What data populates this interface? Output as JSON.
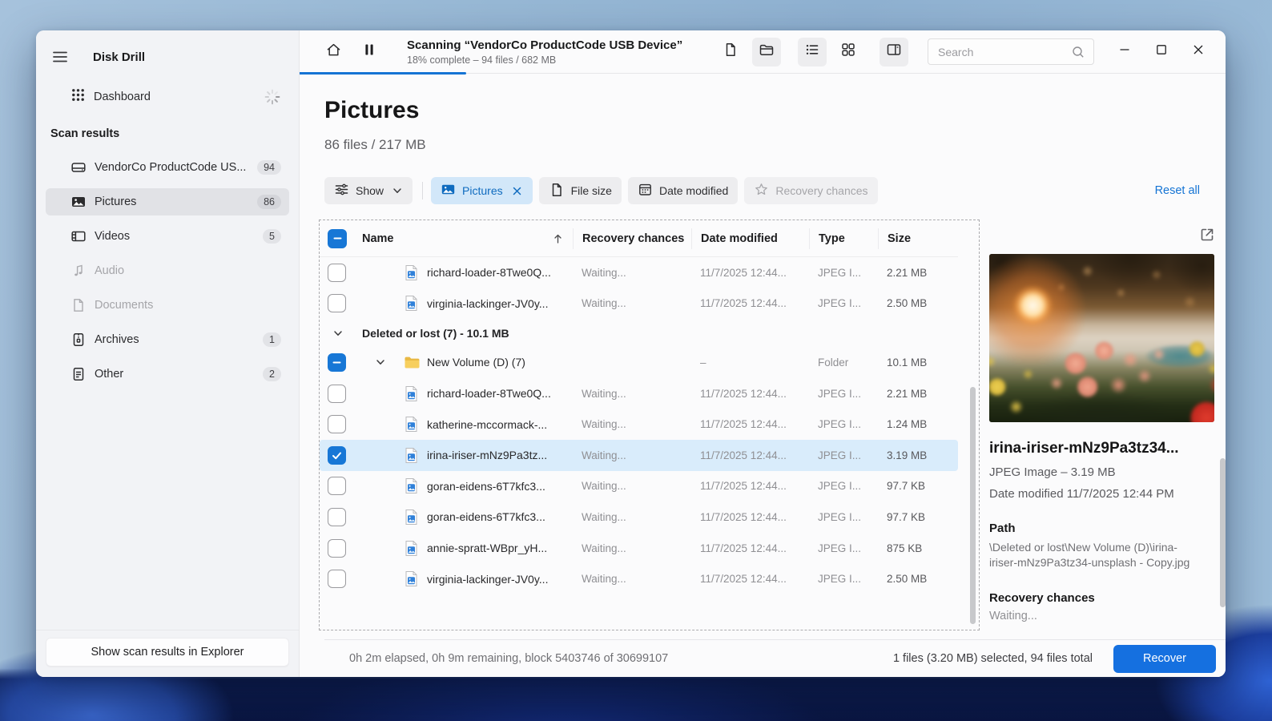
{
  "colors": {
    "accent": "#1574d4",
    "progress_bar": "#1574d4",
    "selection_row": "#d9ecfb",
    "chip_active_bg": "#d2e7f9",
    "chip_active_text": "#0f6bbf",
    "recover_button": "#1570e0",
    "sidebar_bg": "#f2f3f6"
  },
  "sidebar": {
    "title": "Disk Drill",
    "dashboard": {
      "label": "Dashboard",
      "icon": "dashboard",
      "spinner_icon": "spinner"
    },
    "section_header": "Scan results",
    "items": [
      {
        "label": "VendorCo ProductCode US...",
        "count": "94",
        "icon": "drive",
        "state": "normal"
      },
      {
        "label": "Pictures",
        "count": "86",
        "icon": "pictures",
        "state": "selected"
      },
      {
        "label": "Videos",
        "count": "5",
        "icon": "videos",
        "state": "normal"
      },
      {
        "label": "Audio",
        "count": "",
        "icon": "audio",
        "state": "disabled"
      },
      {
        "label": "Documents",
        "count": "",
        "icon": "documents",
        "state": "disabled"
      },
      {
        "label": "Archives",
        "count": "1",
        "icon": "archives",
        "state": "normal"
      },
      {
        "label": "Other",
        "count": "2",
        "icon": "other",
        "state": "normal"
      }
    ],
    "footer_button": "Show scan results in Explorer"
  },
  "header": {
    "title": "Scanning “VendorCo ProductCode USB Device”",
    "subtitle": "18% complete – 94 files / 682 MB",
    "progress_percent": 18,
    "search_placeholder": "Search",
    "toolbar_left": [
      {
        "icon": "home",
        "name": "home-button"
      },
      {
        "icon": "pause",
        "name": "pause-scan-button"
      }
    ],
    "toolbar_right": [
      {
        "icon": "file",
        "name": "file-view-button",
        "active": false
      },
      {
        "icon": "folder-open",
        "name": "folder-view-button",
        "active": true
      },
      {
        "icon": "list-view",
        "name": "list-view-button",
        "active": true
      },
      {
        "icon": "grid-view",
        "name": "grid-view-button",
        "active": false
      },
      {
        "icon": "preview-panel",
        "name": "toggle-preview-panel-button",
        "active": true
      }
    ],
    "window_controls": [
      {
        "icon": "minimize",
        "name": "minimize-button"
      },
      {
        "icon": "maximize",
        "name": "maximize-button"
      },
      {
        "icon": "close",
        "name": "close-button"
      }
    ]
  },
  "main": {
    "title": "Pictures",
    "subtitle": "86 files / 217 MB",
    "filters": {
      "show": {
        "label": "Show",
        "icon": "sliders"
      },
      "chips": [
        {
          "label": "Pictures",
          "icon": "image-blue",
          "variant": "active",
          "closable": true
        },
        {
          "label": "File size",
          "icon": "file",
          "variant": "default"
        },
        {
          "label": "Date modified",
          "icon": "calendar",
          "variant": "default"
        },
        {
          "label": "Recovery chances",
          "icon": "star",
          "variant": "disabled"
        }
      ],
      "reset_label": "Reset all"
    }
  },
  "table": {
    "columns": [
      "Name",
      "Recovery chances",
      "Date modified",
      "Type",
      "Size"
    ],
    "select_all_state": "indeterminate",
    "sort_icon": "sort-ascending",
    "rows": [
      {
        "kind": "file",
        "name": "richard-loader-8Twe0Q...",
        "recovery": "Waiting...",
        "date": "11/7/2025 12:44...",
        "type": "JPEG I...",
        "size": "2.21 MB",
        "checkbox": "unchecked",
        "selected": false
      },
      {
        "kind": "file",
        "name": "virginia-lackinger-JV0y...",
        "recovery": "Waiting...",
        "date": "11/7/2025 12:44...",
        "type": "JPEG I...",
        "size": "2.50 MB",
        "checkbox": "unchecked",
        "selected": false
      },
      {
        "kind": "group",
        "label": "Deleted or lost (7) - 10.1 MB"
      },
      {
        "kind": "folder",
        "name": "New Volume (D) (7)",
        "recovery": "",
        "date": "–",
        "type": "Folder",
        "size": "10.1 MB",
        "checkbox": "indeterminate",
        "selected": false
      },
      {
        "kind": "file",
        "name": "richard-loader-8Twe0Q...",
        "recovery": "Waiting...",
        "date": "11/7/2025 12:44...",
        "type": "JPEG I...",
        "size": "2.21 MB",
        "checkbox": "unchecked",
        "selected": false
      },
      {
        "kind": "file",
        "name": "katherine-mccormack-...",
        "recovery": "Waiting...",
        "date": "11/7/2025 12:44...",
        "type": "JPEG I...",
        "size": "1.24 MB",
        "checkbox": "unchecked",
        "selected": false
      },
      {
        "kind": "file",
        "name": "irina-iriser-mNz9Pa3tz...",
        "recovery": "Waiting...",
        "date": "11/7/2025 12:44...",
        "type": "JPEG I...",
        "size": "3.19 MB",
        "checkbox": "checked",
        "selected": true
      },
      {
        "kind": "file",
        "name": "goran-eidens-6T7kfc3...",
        "recovery": "Waiting...",
        "date": "11/7/2025 12:44...",
        "type": "JPEG I...",
        "size": "97.7 KB",
        "checkbox": "unchecked",
        "selected": false
      },
      {
        "kind": "file",
        "name": "goran-eidens-6T7kfc3...",
        "recovery": "Waiting...",
        "date": "11/7/2025 12:44...",
        "type": "JPEG I...",
        "size": "97.7 KB",
        "checkbox": "unchecked",
        "selected": false
      },
      {
        "kind": "file",
        "name": "annie-spratt-WBpr_yH...",
        "recovery": "Waiting...",
        "date": "11/7/2025 12:44...",
        "type": "JPEG I...",
        "size": "875 KB",
        "checkbox": "unchecked",
        "selected": false
      },
      {
        "kind": "file",
        "name": "virginia-lackinger-JV0y...",
        "recovery": "Waiting...",
        "date": "11/7/2025 12:44...",
        "type": "JPEG I...",
        "size": "2.50 MB",
        "checkbox": "unchecked",
        "selected": false
      }
    ]
  },
  "preview": {
    "open_icon": "open-external",
    "title": "irina-iriser-mNz9Pa3tz34...",
    "type_size": "JPEG Image – 3.19 MB",
    "date_modified": "Date modified 11/7/2025 12:44 PM",
    "path_label": "Path",
    "path_value": "\\Deleted or lost\\New Volume (D)\\irina-iriser-mNz9Pa3tz34-unsplash - Copy.jpg",
    "recovery_label": "Recovery chances",
    "recovery_value": "Waiting..."
  },
  "statusbar": {
    "left": "0h 2m elapsed, 0h 9m remaining, block 5403746 of 30699107",
    "selected": "1 files (3.20 MB) selected, 94 files total",
    "recover_label": "Recover"
  }
}
